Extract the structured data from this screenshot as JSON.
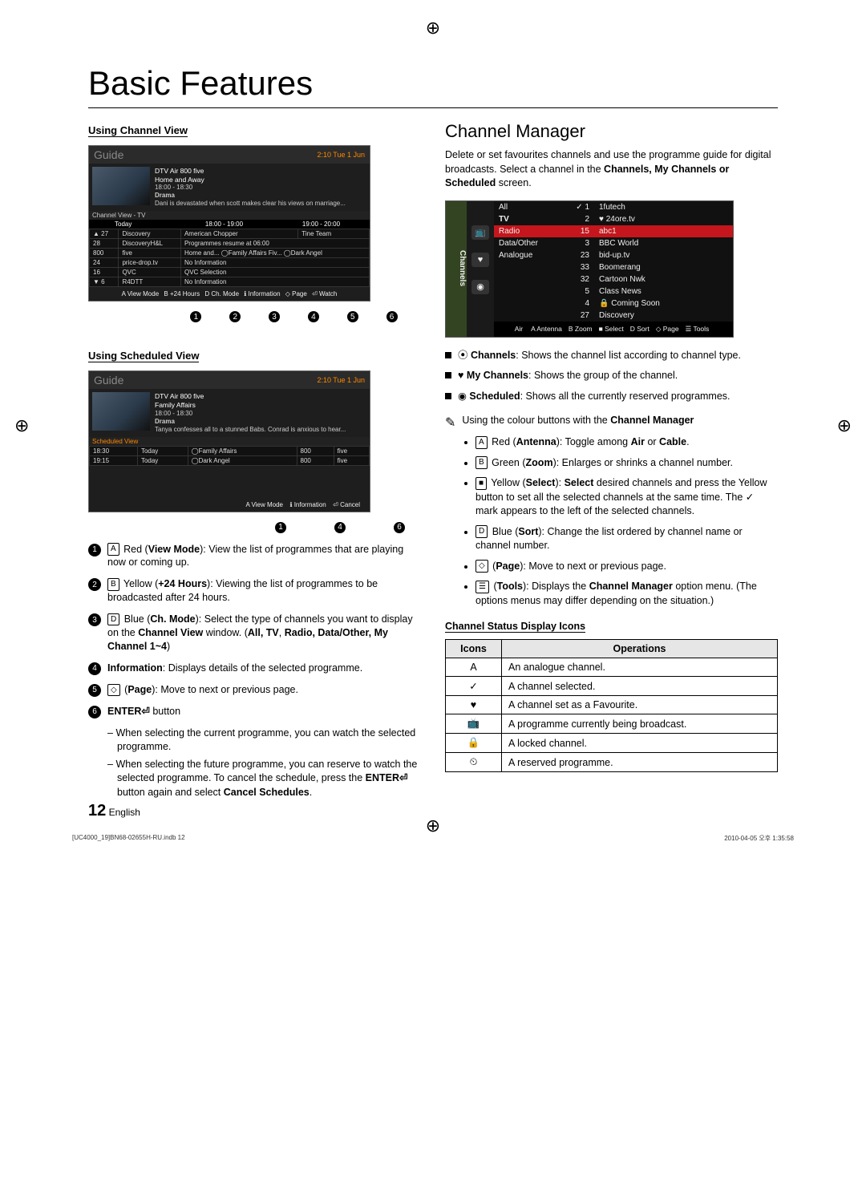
{
  "title": "Basic Features",
  "left": {
    "using_channel_view": "Using Channel View",
    "using_scheduled_view": "Using Scheduled View",
    "guide1": {
      "title": "Guide",
      "time": "2:10 Tue 1 Jun",
      "channel": "DTV Air 800 five",
      "programme": "Home and Away",
      "slot": "18:00 - 18:30",
      "genre": "Drama",
      "desc": "Dani is devastated when scott makes clear his views on marriage...",
      "cv_label": "Channel View - TV",
      "today": "Today",
      "h1": "18:00 - 19:00",
      "h2": "19:00 - 20:00",
      "rows": [
        {
          "arrow": "▲",
          "num": "27",
          "name": "Discovery",
          "a": "American Chopper",
          "b": "Tine Team"
        },
        {
          "arrow": "",
          "num": "28",
          "name": "DiscoveryH&L",
          "a": "Programmes resume at 06:00",
          "b": ""
        },
        {
          "arrow": "",
          "num": "800",
          "name": "five",
          "a": "Home and...   ◯Family Affairs   Fiv...   ◯Dark Angel",
          "b": ""
        },
        {
          "arrow": "",
          "num": "24",
          "name": "price-drop.tv",
          "a": "No Information",
          "b": ""
        },
        {
          "arrow": "",
          "num": "16",
          "name": "QVC",
          "a": "QVC Selection",
          "b": ""
        },
        {
          "arrow": "▼",
          "num": "6",
          "name": "R4DTT",
          "a": "No Information",
          "b": ""
        }
      ],
      "toolbar": [
        "A View Mode",
        "B +24 Hours",
        "D Ch. Mode",
        "ℹ Information",
        "◇ Page",
        "⏎ Watch"
      ],
      "callouts": [
        "1",
        "2",
        "3",
        "4",
        "5",
        "6"
      ]
    },
    "guide2": {
      "title": "Guide",
      "time": "2:10 Tue 1 Jun",
      "channel": "DTV Air 800 five",
      "programme": "Family Affairs",
      "slot": "18:00 - 18:30",
      "genre": "Drama",
      "desc": "Tanya confesses all to a stunned Babs. Conrad is anxious to hear...",
      "sv_label": "Scheduled View",
      "rows": [
        {
          "t": "18:30",
          "d": "Today",
          "p": "◯Family Affairs",
          "n": "800",
          "c": "five"
        },
        {
          "t": "19:15",
          "d": "Today",
          "p": "◯Dark Angel",
          "n": "800",
          "c": "five"
        }
      ],
      "toolbar": [
        "A View Mode",
        "ℹ Information",
        "⏎ Cancel"
      ],
      "callouts": [
        "1",
        "4",
        "6"
      ]
    },
    "items": [
      {
        "n": "1",
        "pre": "A",
        "colour": "red",
        "text": "Red (View Mode): View the list of programmes that are playing now or coming up."
      },
      {
        "n": "2",
        "pre": "B",
        "colour": "yellow",
        "text": "Yellow (+24 Hours): Viewing the list of programmes to be broadcasted after 24 hours."
      },
      {
        "n": "3",
        "pre": "D",
        "colour": "blue",
        "text": "Blue (Ch. Mode): Select the type of channels you want to display on the Channel View window. (All, TV, Radio, Data/Other, My Channel 1~4)"
      },
      {
        "n": "4",
        "pre": "",
        "colour": "",
        "text": "Information: Displays details of the selected programme."
      },
      {
        "n": "5",
        "pre": "◇",
        "colour": "",
        "text": "(Page): Move to next or previous page."
      },
      {
        "n": "6",
        "pre": "",
        "colour": "",
        "text": "ENTER⏎ button"
      }
    ],
    "item6_sub": [
      "When selecting the current programme, you can watch the selected programme.",
      "When selecting the future programme, you can reserve to watch the selected programme. To cancel the schedule, press the ENTER⏎ button again and select Cancel Schedules."
    ]
  },
  "right": {
    "title": "Channel Manager",
    "intro1": "Delete or set favourites channels and use the programme guide for digital broadcasts. Select a channel in the ",
    "intro_bold": "Channels, My Channels or Scheduled",
    "intro2": " screen.",
    "mgr": {
      "sidebar": "Channels",
      "cols": {
        "c1_rows": [
          "All",
          "TV",
          "Radio",
          "Data/Other",
          "Analogue"
        ],
        "c2_rows": [
          "✓ 1",
          "2",
          "15",
          "3",
          "23",
          "33",
          "32",
          "5",
          "4",
          "27"
        ],
        "c3_rows": [
          "1futech",
          "♥ 24ore.tv",
          "abc1",
          "BBC World",
          "bid-up.tv",
          "Boomerang",
          "Cartoon Nwk",
          "Class News",
          "🔒 Coming Soon",
          "Discovery"
        ]
      },
      "bottom_left": "Air",
      "bottom": [
        "A Antenna",
        "B Zoom",
        "■ Select",
        "D Sort",
        "◇ Page",
        "☰ Tools"
      ]
    },
    "bullets": [
      {
        "icon": "⦿",
        "b": "Channels",
        "t": ": Shows the channel list according to channel type."
      },
      {
        "icon": "♥",
        "b": "My Channels",
        "t": ": Shows the group of the channel."
      },
      {
        "icon": "◉",
        "b": "Scheduled",
        "t": ": Shows all the currently reserved programmes."
      }
    ],
    "hint": "Using the colour buttons with the Channel Manager",
    "sub_bullets": [
      {
        "badge": "A",
        "text": "Red (Antenna): Toggle among Air or Cable."
      },
      {
        "badge": "B",
        "text": "Green (Zoom): Enlarges or shrinks a channel number."
      },
      {
        "badge": "■",
        "text": "Yellow (Select): Select desired channels and press the Yellow button to set all the selected channels at the same time. The ✓ mark appears to the left of the selected channels."
      },
      {
        "badge": "D",
        "text": "Blue (Sort): Change the list ordered by channel name or channel number."
      },
      {
        "badge": "◇",
        "text": "(Page): Move to next or previous page."
      },
      {
        "badge": "☰",
        "text": "(Tools): Displays the Channel Manager option menu. (The options menus may differ depending on the situation.)"
      }
    ],
    "tbl_title": "Channel Status Display Icons",
    "tbl_headers": {
      "c1": "Icons",
      "c2": "Operations"
    },
    "tbl_rows": [
      {
        "icon": "A",
        "op": "An analogue channel."
      },
      {
        "icon": "✓",
        "op": "A channel selected."
      },
      {
        "icon": "♥",
        "op": "A channel set as a Favourite."
      },
      {
        "icon": "📺",
        "op": "A programme currently being broadcast."
      },
      {
        "icon": "🔒",
        "op": "A locked channel."
      },
      {
        "icon": "⏲",
        "op": "A reserved programme."
      }
    ]
  },
  "footer": {
    "page": "12",
    "lang": "English"
  },
  "print_footer": {
    "left": "[UC4000_19]BN68-02655H-RU.indb   12",
    "right": "2010-04-05   오후 1:35:58"
  }
}
